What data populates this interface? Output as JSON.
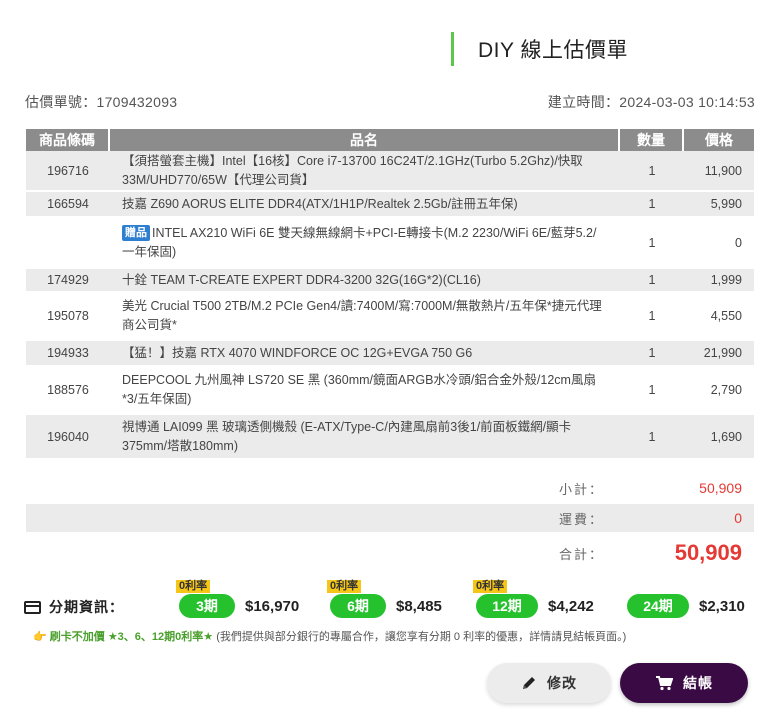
{
  "title": "DIY 線上估價單",
  "quote_no_label": "估價單號：1709432093",
  "created_label": "建立時間：2024-03-03 10:14:53",
  "table": {
    "headers": [
      "商品條碼",
      "品名",
      "數量",
      "價格"
    ],
    "rows": [
      {
        "code": "196716",
        "gift": "",
        "name": "【須搭螢套主機】Intel【16核】Core i7-13700 16C24T/2.1GHz(Turbo 5.2Ghz)/快取33M/UHD770/65W【代理公司貨】",
        "qty": "1",
        "price": "11,900"
      },
      {
        "code": "166594",
        "gift": "",
        "name": "技嘉 Z690 AORUS ELITE DDR4(ATX/1H1P/Realtek 2.5Gb/註冊五年保)",
        "qty": "1",
        "price": "5,990"
      },
      {
        "code": "",
        "gift": "贈品",
        "name": "INTEL AX210 WiFi 6E 雙天線無線網卡+PCI-E轉接卡(M.2 2230/WiFi 6E/藍芽5.2/一年保固)",
        "qty": "1",
        "price": "0"
      },
      {
        "code": "174929",
        "gift": "",
        "name": "十銓 TEAM T-CREATE EXPERT DDR4-3200 32G(16G*2)(CL16)",
        "qty": "1",
        "price": "1,999"
      },
      {
        "code": "195078",
        "gift": "",
        "name": "美光 Crucial T500 2TB/M.2 PCIe Gen4/讀:7400M/寫:7000M/無散熱片/五年保*捷元代理商公司貨*",
        "qty": "1",
        "price": "4,550"
      },
      {
        "code": "194933",
        "gift": "",
        "name": "【猛！】技嘉 RTX 4070 WINDFORCE OC 12G+EVGA 750 G6",
        "qty": "1",
        "price": "21,990"
      },
      {
        "code": "188576",
        "gift": "",
        "name": "DEEPCOOL 九州風神 LS720 SE 黑 (360mm/鏡面ARGB水冷頭/鋁合金外殼/12cm風扇*3/五年保固)",
        "qty": "1",
        "price": "2,790"
      },
      {
        "code": "196040",
        "gift": "",
        "name": "視博通 LAI099 黑 玻璃透側機殼 (E-ATX/Type-C/內建風扇前3後1/前面板鐵網/顯卡375mm/塔散180mm)",
        "qty": "1",
        "price": "1,690"
      }
    ]
  },
  "summary": {
    "subtotal_label": "小計：",
    "subtotal": "50,909",
    "shipping_label": "運費：",
    "shipping": "0",
    "total_label": "合計：",
    "total": "50,909"
  },
  "installments": {
    "label": "分期資訊：",
    "zero_tag": "0利率",
    "plans": [
      {
        "term": "3期",
        "amount": "$16,970",
        "zero": true
      },
      {
        "term": "6期",
        "amount": "$8,485",
        "zero": true
      },
      {
        "term": "12期",
        "amount": "$4,242",
        "zero": true
      },
      {
        "term": "24期",
        "amount": "$2,310",
        "zero": false
      }
    ]
  },
  "note": {
    "hand": "👉",
    "bold": "刷卡不加價  ★3、6、12期0利率★",
    "text": "(我們提供與部分銀行的專屬合作，讓您享有分期 0 利率的優惠，詳情請見結帳頁面。)"
  },
  "buttons": {
    "edit": "修改",
    "checkout": "結帳"
  },
  "colors": {
    "accent_green": "#26c22e",
    "price_red": "#e53935",
    "checkout_purple": "#3a0a45",
    "header_gray": "#8c8c8c"
  },
  "icons": [
    "credit-card-icon",
    "pencil-icon",
    "cart-icon"
  ]
}
